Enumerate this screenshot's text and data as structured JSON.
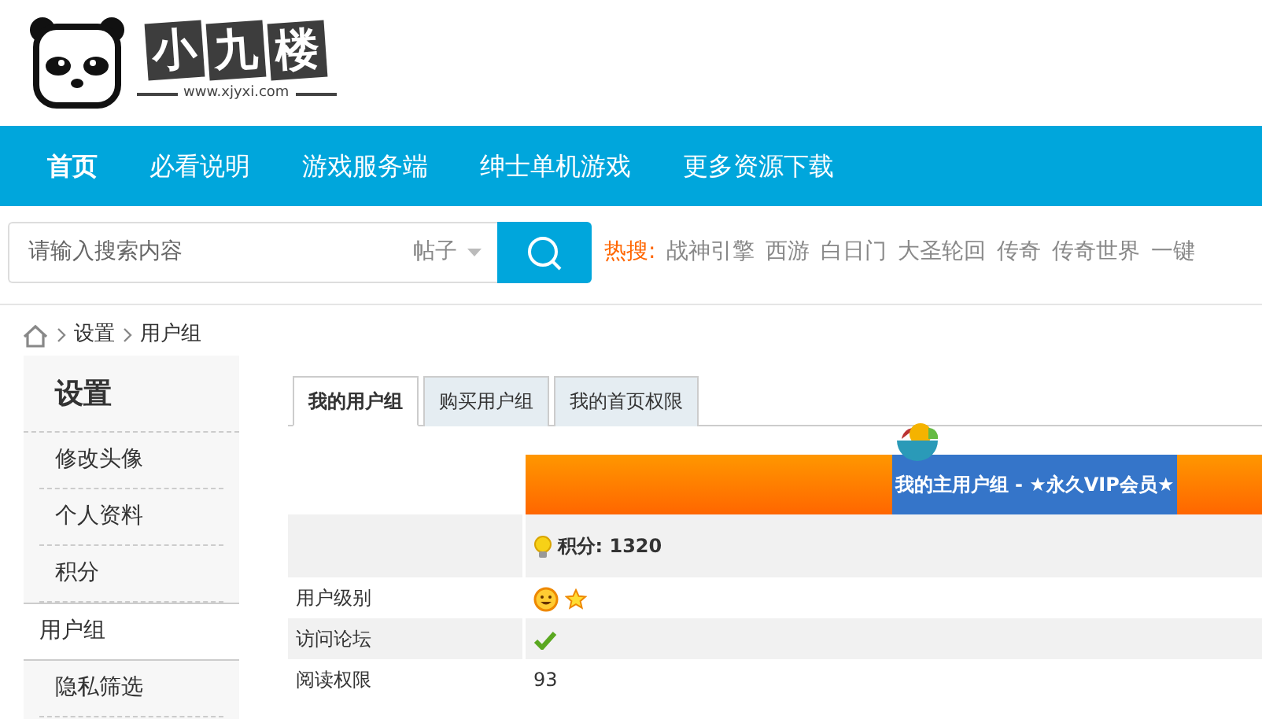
{
  "logo": {
    "name": [
      "小",
      "九",
      "楼"
    ],
    "url": "www.xjyxi.com"
  },
  "nav": [
    {
      "label": "首页",
      "selected": true
    },
    {
      "label": "必看说明",
      "selected": false
    },
    {
      "label": "游戏服务端",
      "selected": false
    },
    {
      "label": "绅士单机游戏",
      "selected": false
    },
    {
      "label": "更多资源下载",
      "selected": false
    }
  ],
  "search": {
    "placeholder": "请输入搜索内容",
    "scope": "帖子"
  },
  "hot": {
    "label": "热搜:",
    "terms": [
      "战神引擎",
      "西游",
      "白日门",
      "大圣轮回",
      "传奇",
      "传奇世界",
      "一键"
    ]
  },
  "breadcrumb": [
    "设置",
    "用户组"
  ],
  "sidebar": {
    "title": "设置",
    "items": [
      {
        "label": "修改头像",
        "selected": false
      },
      {
        "label": "个人资料",
        "selected": false
      },
      {
        "label": "积分",
        "selected": false
      },
      {
        "label": "用户组",
        "selected": true
      },
      {
        "label": "隐私筛选",
        "selected": false
      }
    ]
  },
  "tabs": [
    {
      "label": "我的用户组",
      "selected": true
    },
    {
      "label": "购买用户组",
      "selected": false
    },
    {
      "label": "我的首页权限",
      "selected": false
    }
  ],
  "group": {
    "title": "我的主用户组 - ★永久VIP会员★",
    "score": "积分: 1320"
  },
  "rows": [
    {
      "label": "用户级别",
      "kind": "level"
    },
    {
      "label": "访问论坛",
      "kind": "check"
    },
    {
      "label": "阅读权限",
      "kind": "text",
      "value": "93"
    }
  ]
}
